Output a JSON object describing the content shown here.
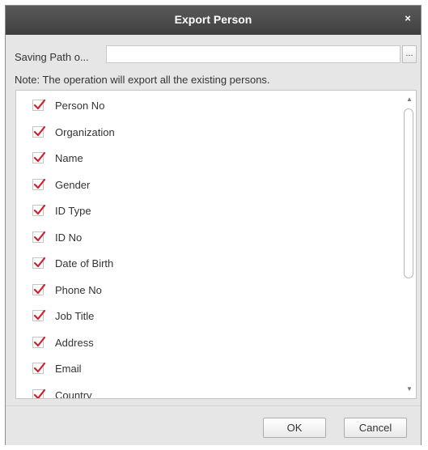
{
  "dialog": {
    "title": "Export Person",
    "close_icon": "close-icon",
    "close_glyph": "×"
  },
  "saving_path": {
    "label": "Saving Path o...",
    "value": "",
    "browse_label": "..."
  },
  "note": "Note: The operation will export all the existing persons.",
  "fields": [
    {
      "label": "Person No",
      "checked": true
    },
    {
      "label": "Organization",
      "checked": true
    },
    {
      "label": "Name",
      "checked": true
    },
    {
      "label": "Gender",
      "checked": true
    },
    {
      "label": "ID Type",
      "checked": true
    },
    {
      "label": "ID No",
      "checked": true
    },
    {
      "label": "Date of Birth",
      "checked": true
    },
    {
      "label": "Phone No",
      "checked": true
    },
    {
      "label": "Job Title",
      "checked": true
    },
    {
      "label": "Address",
      "checked": true
    },
    {
      "label": "Email",
      "checked": true
    },
    {
      "label": "Country",
      "checked": true
    }
  ],
  "scrollbar": {
    "up_glyph": "▲",
    "down_glyph": "▼"
  },
  "buttons": {
    "ok": "OK",
    "cancel": "Cancel"
  },
  "colors": {
    "titlebar": "#4a4a4a",
    "check_mark": "#d0212b",
    "dialog_bg": "#e6e6e6"
  }
}
